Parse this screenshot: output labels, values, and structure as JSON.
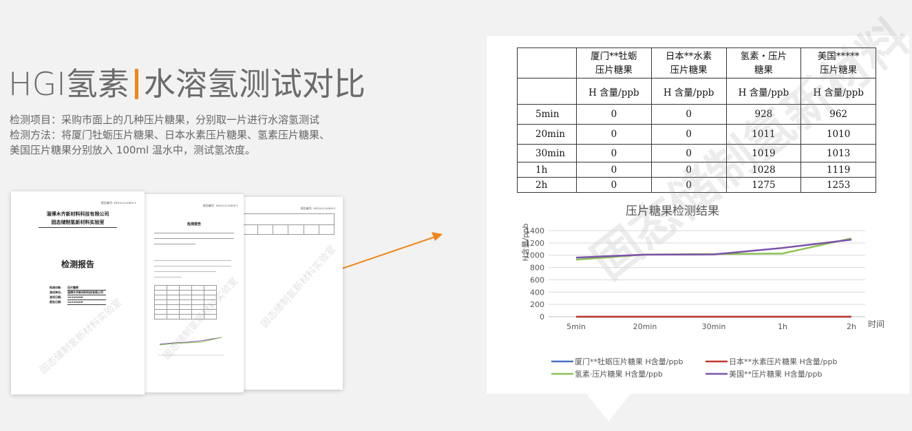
{
  "header": {
    "title_left": "HGI氢素",
    "title_right": "水溶氢测试对比",
    "accent": "#f08519"
  },
  "description": {
    "line1": "检测项目：采购市面上的几种压片糖果，分别取一片进行水溶氢测试",
    "line2": "检测方法：将厦门牡蛎压片糖果、日本水素压片糖果、氢素压片糖果、",
    "line3": "美国压片糖果分别放入 100ml 温水中，测试氢浓度。"
  },
  "report": {
    "org_line1": "淄博木齐新材料科技有限公司",
    "org_line2": "固态储制氢新材料实验室",
    "report_title": "检测报告",
    "page_title": "检测报告",
    "fields": [
      {
        "label": "检测对象:",
        "value": "压片糖果"
      },
      {
        "label": "测试单位:",
        "value": "淄博木齐新材料科技有限公司"
      },
      {
        "label": "测试日期:",
        "value": "20220408"
      },
      {
        "label": "报告日期:",
        "value": "20220408"
      }
    ],
    "watermark": "固态储制氢新材料实验室"
  },
  "results": {
    "col_headers": [
      "厦门**牡蛎\n压片糖果",
      "日本**水素\n压片糖果",
      "氢素・压片\n糖果",
      "美国*****\n压片糖果"
    ],
    "unit_row": [
      "H 含量/ppb",
      "H 含量/ppb",
      "H 含量/ppb",
      "H 含量/ppb"
    ],
    "rows": [
      {
        "label": "5min",
        "values": [
          "0",
          "0",
          "928",
          "962"
        ]
      },
      {
        "label": "20min",
        "values": [
          "0",
          "0",
          "1011",
          "1010"
        ]
      },
      {
        "label": "30min",
        "values": [
          "0",
          "0",
          "1019",
          "1013"
        ]
      },
      {
        "label": "1h",
        "values": [
          "0",
          "0",
          "1028",
          "1119"
        ]
      },
      {
        "label": "2h",
        "values": [
          "0",
          "0",
          "1275",
          "1253"
        ]
      }
    ],
    "watermark": "固态储制氢新材料"
  },
  "chart_data": {
    "type": "line",
    "title": "压片糖果检测结果",
    "ylabel": "H含量/ppb",
    "xlabel": "时间",
    "categories": [
      "5min",
      "20min",
      "30min",
      "1h",
      "2h"
    ],
    "ylim": [
      0,
      1400
    ],
    "yticks": [
      "0",
      "200",
      "400",
      "600",
      "800",
      "1000",
      "1200",
      "1400"
    ],
    "grid": true,
    "legend_position": "bottom",
    "series": [
      {
        "name": "厦门**牡蛎压片糖果 H含量/ppb",
        "color": "#4472c4",
        "values": [
          0,
          0,
          0,
          0,
          0
        ]
      },
      {
        "name": "日本**水素压片糖果 H含量/ppb",
        "color": "#c0392b",
        "values": [
          0,
          0,
          0,
          0,
          0
        ]
      },
      {
        "name": "氢素·压片糖果 H含量/ppb",
        "color": "#8cc152",
        "values": [
          928,
          1011,
          1019,
          1028,
          1275
        ]
      },
      {
        "name": "美国**压片糖果 H含量/ppb",
        "color": "#7b52ab",
        "values": [
          962,
          1010,
          1013,
          1119,
          1253
        ]
      }
    ]
  }
}
